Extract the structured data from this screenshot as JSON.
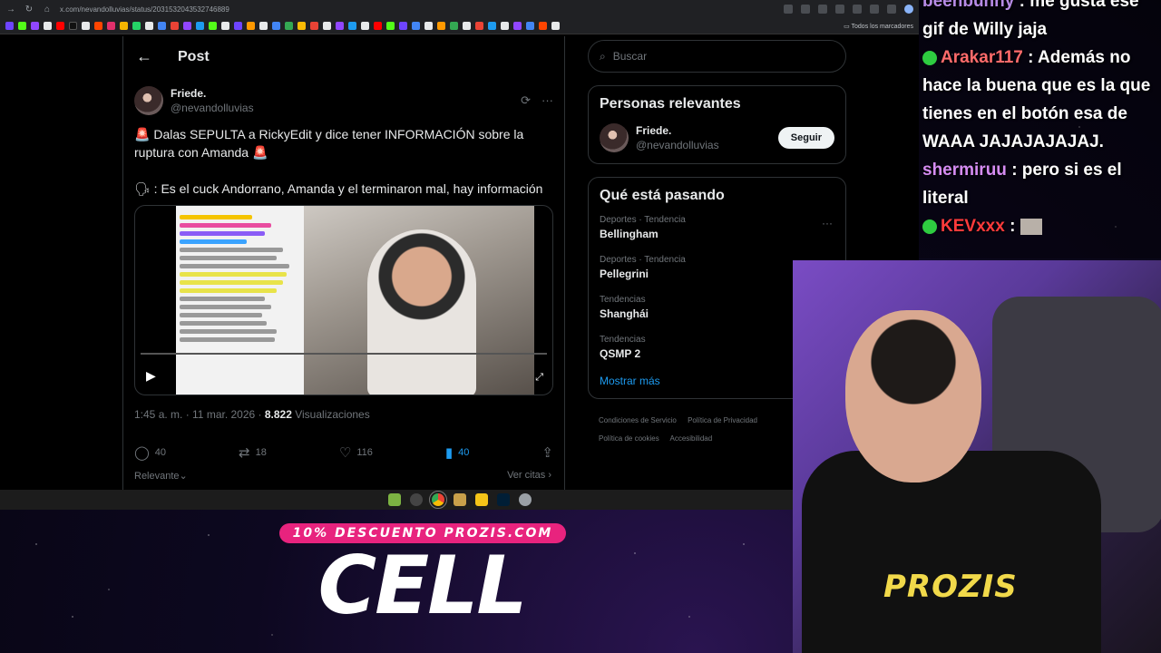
{
  "browser": {
    "url": "x.com/nevandolluvias/status/2031532043532746889",
    "bookmarks_folder": "Todos los marcadores"
  },
  "post": {
    "header_title": "Post",
    "author_name": "Friede.",
    "author_handle": "@nevandolluvias",
    "text_line1": "Dalas SEPULTA a RickyEdit y dice tener INFORMACIÓN sobre la ruptura con Amanda",
    "text_line2": ": Es el cuck Andorrano, Amanda y el terminaron mal, hay información",
    "siren_emoji": "🚨",
    "speaker_emoji": "🗣",
    "timestamp": "1:45 a. m. · 11 mar. 2026 · ",
    "views_count": "8.822",
    "views_label": " Visualizaciones",
    "replies": "40",
    "reposts": "18",
    "likes": "116",
    "bookmarks": "40",
    "sort_label": "Relevante",
    "quotes_link": "Ver citas"
  },
  "sidebar": {
    "search_placeholder": "Buscar",
    "relevant_title": "Personas relevantes",
    "relevant_name": "Friede.",
    "relevant_handle": "@nevandolluvias",
    "follow_label": "Seguir",
    "trending_title": "Qué está pasando",
    "trends": [
      {
        "category": "Deportes · Tendencia",
        "name": "Bellingham"
      },
      {
        "category": "Deportes · Tendencia",
        "name": "Pellegrini"
      },
      {
        "category": "Tendencias",
        "name": "Shanghái"
      },
      {
        "category": "Tendencias",
        "name": "QSMP 2"
      }
    ],
    "show_more": "Mostrar más",
    "footer": [
      "Condiciones de Servicio",
      "Política de Privacidad",
      "Política de cookies",
      "Accesibilidad"
    ]
  },
  "chat": [
    {
      "user": "beenbunny",
      "text": ": me gusta ese gif de Willy jaja",
      "color": "#b78be6"
    },
    {
      "user": "Arakar117",
      "text": ": Además no hace la buena que es la que tienes en el botón esa de WAAA JAJAJAJAJAJ.",
      "color": "#ff6b6b"
    },
    {
      "user": "shermiruu",
      "text": ": pero si es el literal",
      "color": "#d58cf2"
    },
    {
      "user": "KEVxxx",
      "text": ":",
      "color": "#ff3b3b"
    }
  ],
  "promo": {
    "tag": "10% DESCUENTO PROZIS.COM",
    "big": "CELL"
  },
  "webcam": {
    "shirt_logo": "PROZIS"
  },
  "colors": {
    "accent": "#1d9bf0",
    "promo_pink": "#e8237e"
  }
}
